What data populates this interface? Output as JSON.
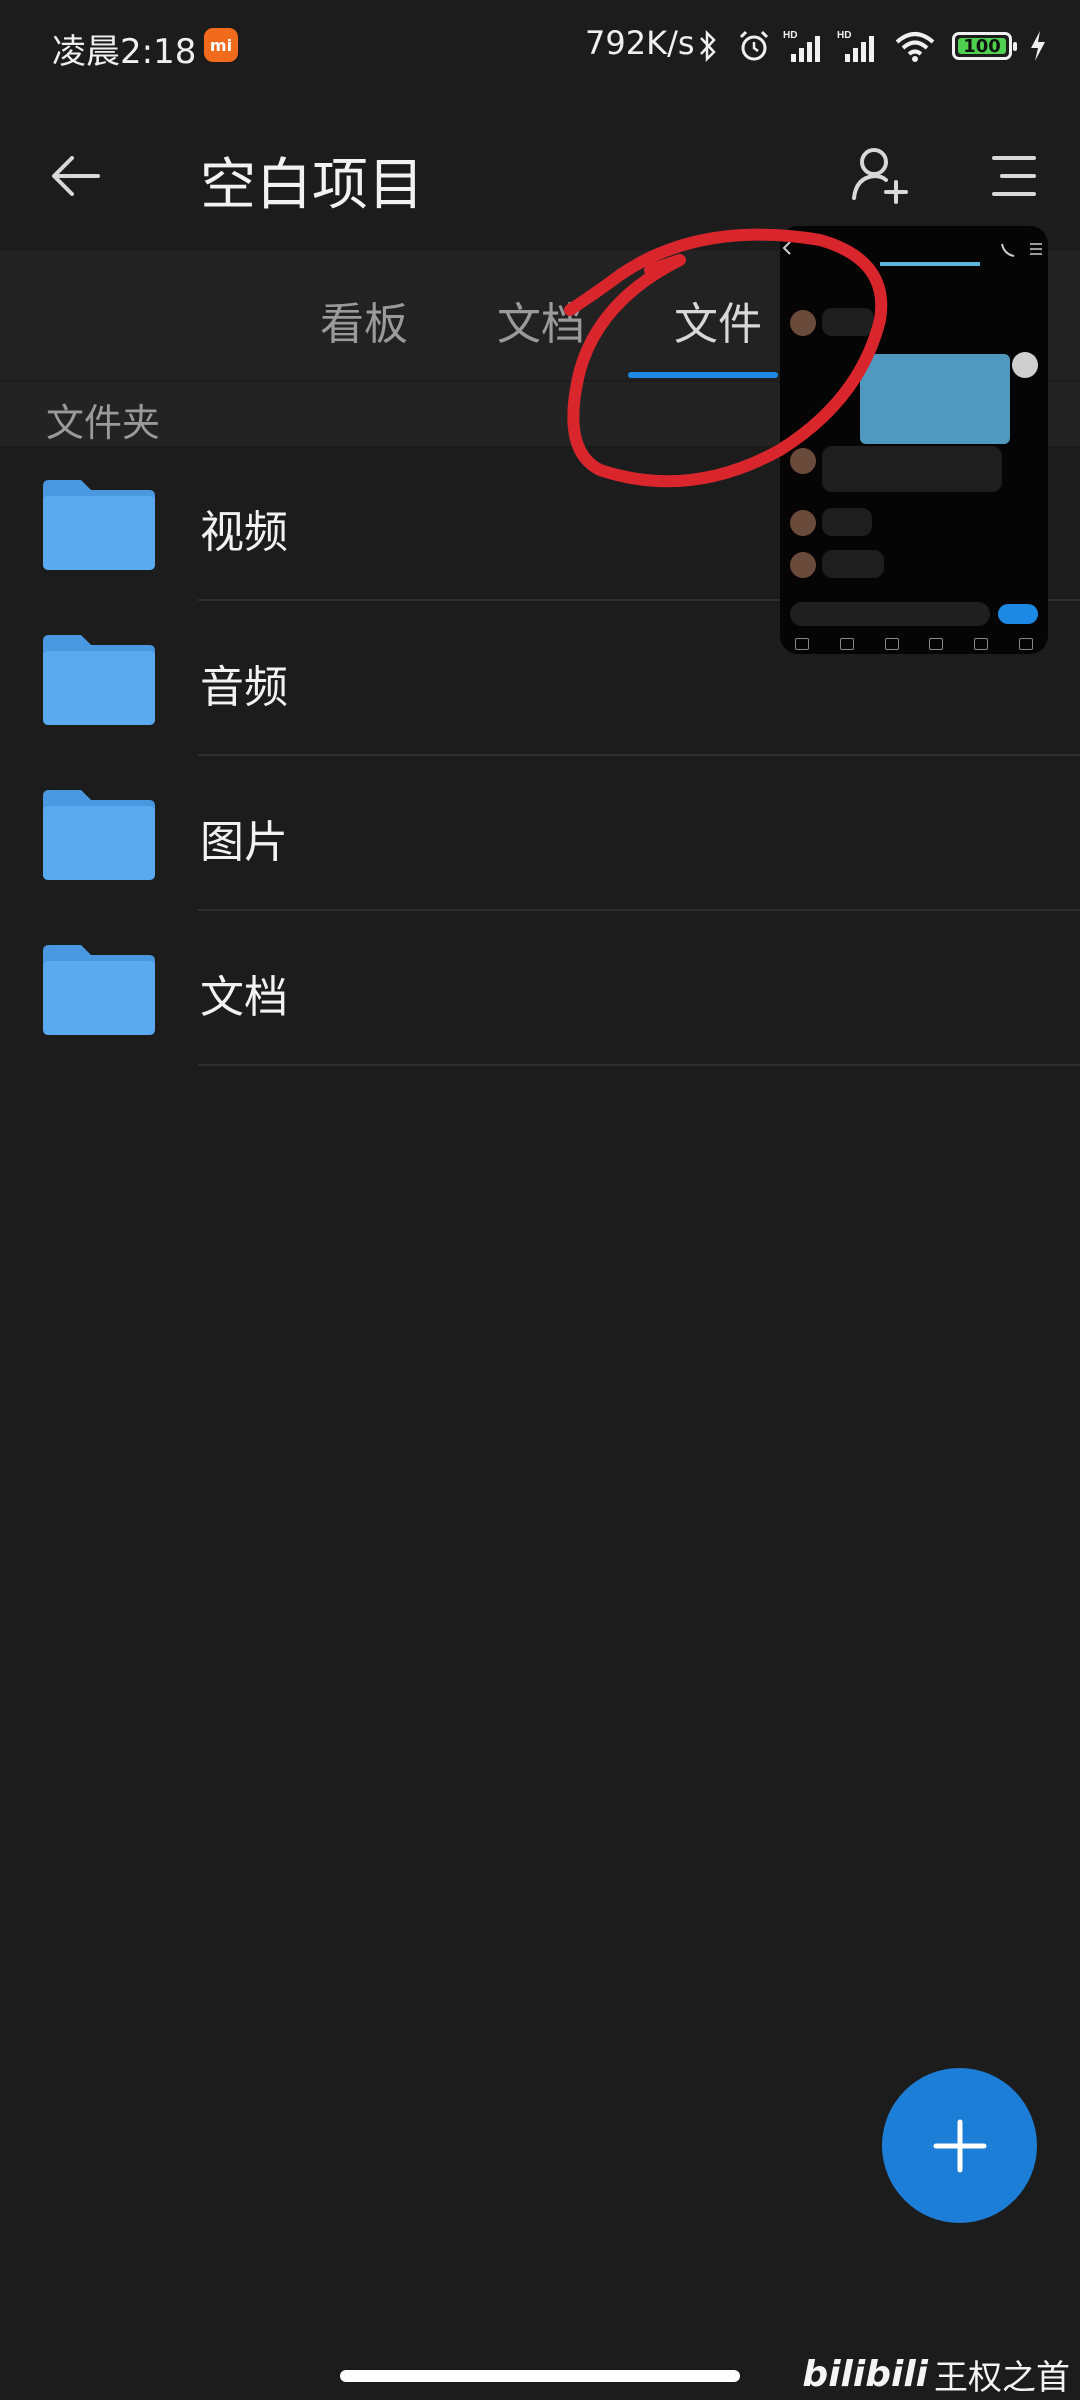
{
  "status_bar": {
    "time": "凌晨2:18",
    "network_speed": "792K/s",
    "battery_level": "100",
    "icons": [
      "mi-app-icon",
      "bluetooth-icon",
      "alarm-icon",
      "signal-hd-icon",
      "signal-hd-icon",
      "wifi-icon",
      "battery-icon",
      "charging-icon"
    ]
  },
  "header": {
    "title": "空白项目",
    "icons": [
      "back-arrow-icon",
      "add-member-icon",
      "menu-icon"
    ]
  },
  "tabs": [
    {
      "label": "看板"
    },
    {
      "label": "文档"
    },
    {
      "label": "文件",
      "active": true
    }
  ],
  "section": {
    "label": "文件夹"
  },
  "folders": [
    {
      "label": "视频"
    },
    {
      "label": "音频"
    },
    {
      "label": "图片"
    },
    {
      "label": "文档"
    }
  ],
  "fab": {
    "icon": "plus-icon"
  },
  "watermark": {
    "logo": "bilibili",
    "text": "王权之首"
  },
  "colors": {
    "background": "#1c1c1c",
    "accent": "#1e88e5",
    "folder": "#5aaaf0",
    "annotation": "#d8262c"
  }
}
